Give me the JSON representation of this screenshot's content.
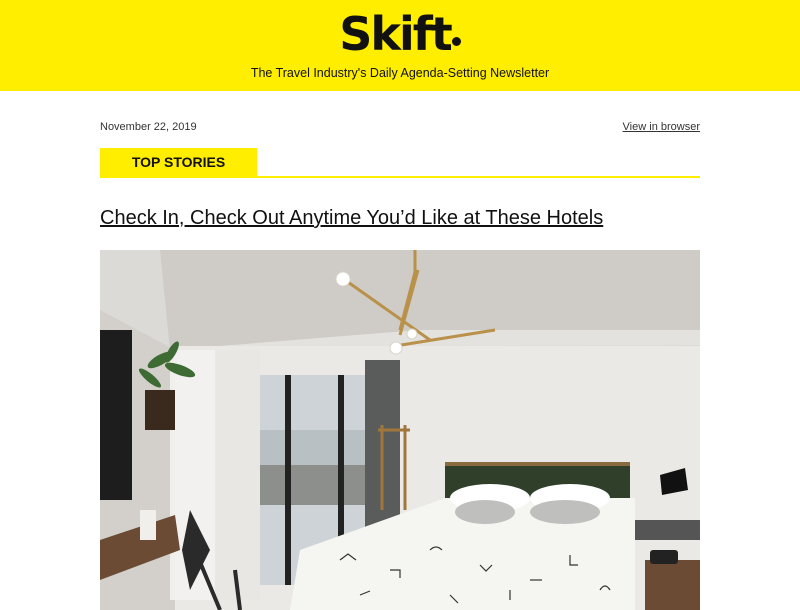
{
  "header": {
    "logo_text": "Skift",
    "tagline": "The Travel Industry's Daily Agenda-Setting Newsletter",
    "background_color": "#ffee00"
  },
  "meta": {
    "date": "November 22, 2019",
    "view_in_browser": "View in browser"
  },
  "section": {
    "label": "TOP STORIES"
  },
  "story": {
    "headline": "Check In, Check Out Anytime You’d Like at These Hotels",
    "image_alt": "hotel room with bed, chandelier and window"
  }
}
